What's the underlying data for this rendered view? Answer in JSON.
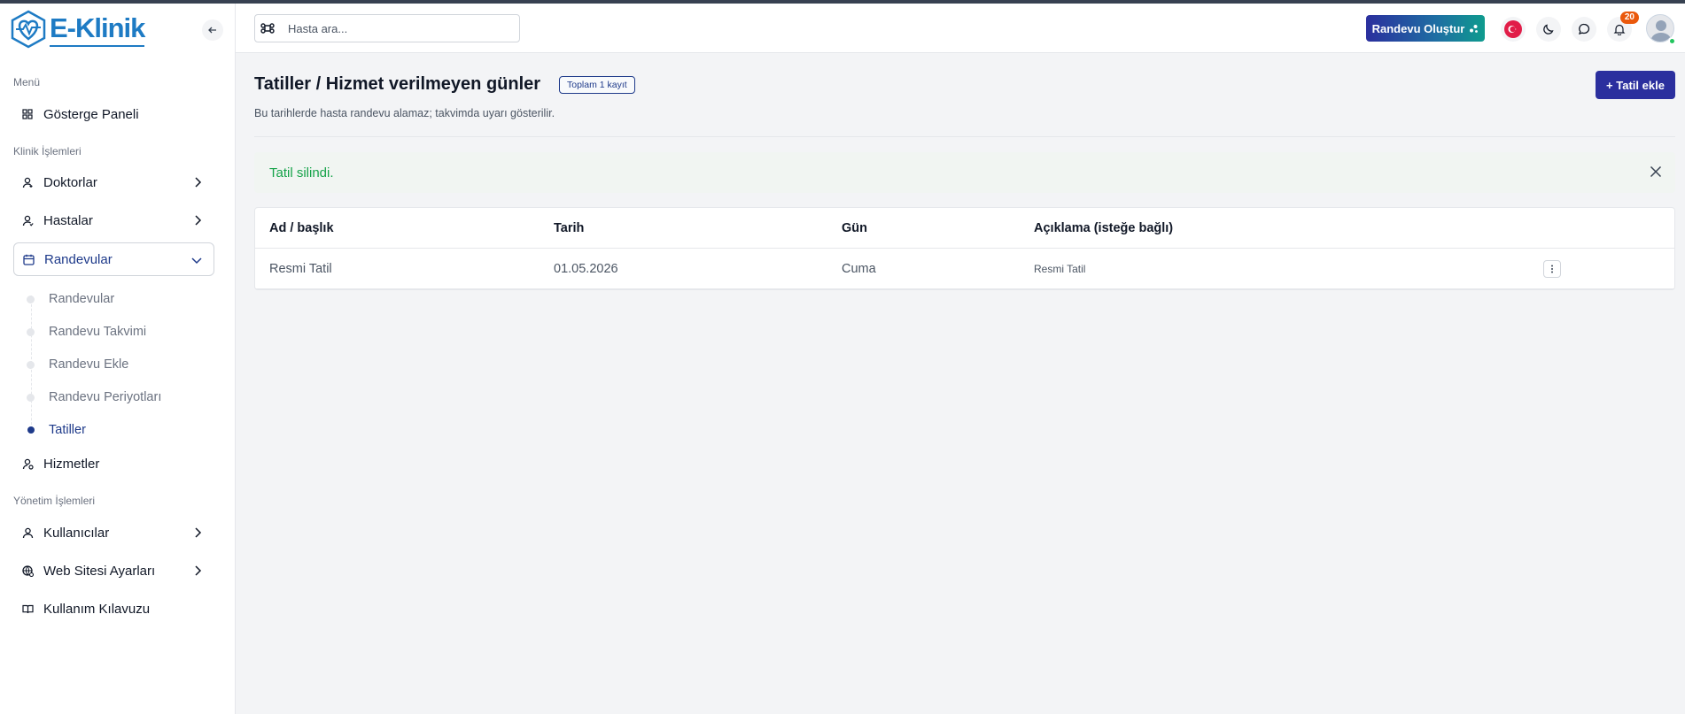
{
  "brand": {
    "name": "E-Klinik",
    "color": "#1e7bc4"
  },
  "colors": {
    "primary": "#2b2f9e",
    "success": "#16a34a",
    "notification": "#ea580c",
    "active_nav": "#1e3a8a"
  },
  "sidebar": {
    "sections": [
      {
        "label": "Menü"
      },
      {
        "label": "Klinik İşlemleri"
      },
      {
        "label": "Yönetim İşlemleri"
      }
    ],
    "items": [
      {
        "label": "Gösterge Paneli",
        "icon": "dashboard-icon"
      },
      {
        "label": "Doktorlar",
        "icon": "user-doctor-icon"
      },
      {
        "label": "Hastalar",
        "icon": "user-patient-icon"
      },
      {
        "label": "Randevular",
        "icon": "calendar-icon",
        "expanded": true
      },
      {
        "label": "Hizmetler",
        "icon": "service-icon"
      },
      {
        "label": "Kullanıcılar",
        "icon": "user-icon"
      },
      {
        "label": "Web Sitesi Ayarları",
        "icon": "globe-settings-icon"
      },
      {
        "label": "Kullanım Kılavuzu",
        "icon": "book-icon"
      }
    ],
    "sub_items": [
      {
        "label": "Randevular"
      },
      {
        "label": "Randevu Takvimi"
      },
      {
        "label": "Randevu Ekle"
      },
      {
        "label": "Randevu Periyotları"
      },
      {
        "label": "Tatiller",
        "current": true
      }
    ]
  },
  "header": {
    "search_placeholder": "Hasta ara...",
    "create_label": "Randevu Oluştur",
    "notification_count": "20"
  },
  "main": {
    "title": "Tatiller / Hizmet verilmeyen günler",
    "count_badge": "Toplam 1 kayıt",
    "subtitle": "Bu tarihlerde hasta randevu alamaz; takvimda uyarı gösterilir.",
    "add_label": "+ Tatil ekle",
    "alert_text": "Tatil silindi.",
    "table": {
      "columns": [
        "Ad / başlık",
        "Tarih",
        "Gün",
        "Açıklama (isteğe bağlı)"
      ],
      "rows": [
        {
          "name": "Resmi Tatil",
          "date": "01.05.2026",
          "day": "Cuma",
          "description": "Resmi Tatil"
        }
      ]
    }
  }
}
